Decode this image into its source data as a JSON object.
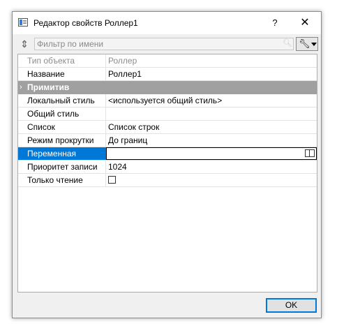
{
  "window": {
    "title": "Редактор свойств Роллер1",
    "help_label": "?",
    "close_label": "✕"
  },
  "toolbar": {
    "filter_placeholder": "Фильтр по имени",
    "filter_value": ""
  },
  "properties": {
    "object_type": {
      "name": "Тип объекта",
      "value": "Роллер"
    },
    "name": {
      "name": "Название",
      "value": "Роллер1"
    },
    "group": {
      "name": "Примитив",
      "expander": "›"
    },
    "local_style": {
      "name": "Локальный стиль",
      "value": "<используется общий стиль>"
    },
    "common_style": {
      "name": "Общий стиль",
      "value": ""
    },
    "list": {
      "name": "Список",
      "value": "Список строк"
    },
    "scroll_mode": {
      "name": "Режим прокрутки",
      "value": "До границ"
    },
    "variable": {
      "name": "Переменная",
      "value": ""
    },
    "write_priority": {
      "name": "Приоритет записи",
      "value": "1024"
    },
    "read_only": {
      "name": "Только чтение",
      "checked": false
    }
  },
  "footer": {
    "ok_label": "OK"
  },
  "colors": {
    "selection": "#0078d7",
    "group_header": "#a0a0a0",
    "dialog_bg": "#f0f0f0"
  }
}
